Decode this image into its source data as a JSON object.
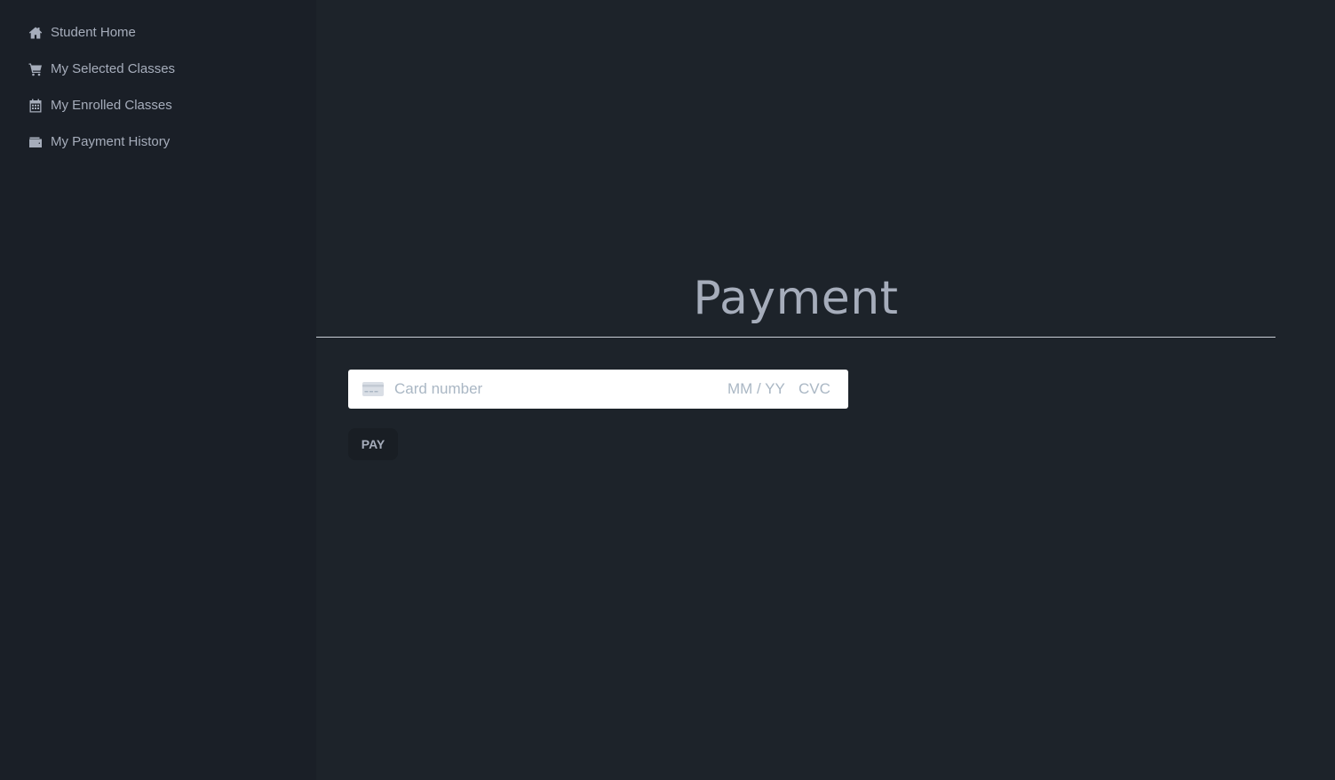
{
  "sidebar": {
    "items": [
      {
        "label": "Student Home",
        "icon": "home-icon"
      },
      {
        "label": "My Selected Classes",
        "icon": "cart-icon"
      },
      {
        "label": "My Enrolled Classes",
        "icon": "calendar-icon"
      },
      {
        "label": "My Payment History",
        "icon": "wallet-icon"
      }
    ]
  },
  "main": {
    "title": "Payment",
    "card": {
      "number_placeholder": "Card number",
      "expiry_placeholder": "MM / YY",
      "cvc_placeholder": "CVC",
      "icon": "credit-card-icon"
    },
    "pay_label": "PAY"
  },
  "colors": {
    "sidebar_bg": "#1a1f27",
    "main_bg": "#1d232a",
    "text": "#a6adbb",
    "button_bg": "#191e24",
    "placeholder": "#aab7c4"
  }
}
